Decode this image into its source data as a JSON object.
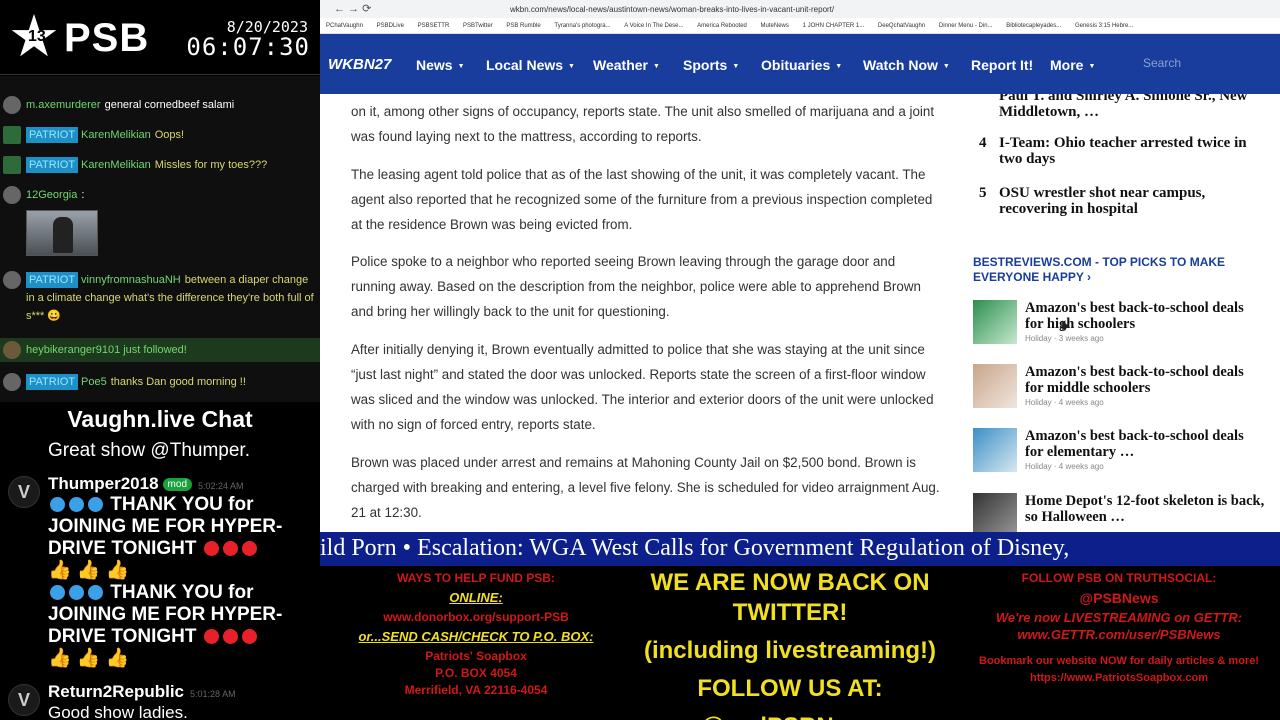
{
  "stream": {
    "logo_text": "PSB",
    "logo_num": "13",
    "date": "8/20/2023",
    "time": "06:07:30"
  },
  "chat_top": {
    "messages": [
      {
        "user": "m.axemurderer",
        "badge": "",
        "text": "general cornedbeef salami"
      },
      {
        "user": "KarenMelikian",
        "badge": "PATRIOT",
        "text": "Oops!"
      },
      {
        "user": "KarenMelikian",
        "badge": "PATRIOT",
        "text": "Missles for my toes???"
      },
      {
        "user": "12Georgia",
        "badge": "",
        "text": ":"
      },
      {
        "user": "vinnyfromnashuaNH",
        "badge": "PATRIOT",
        "text": "between a diaper change in a climate change what's the difference they're both full of s*** 😀"
      },
      {
        "user": "",
        "badge": "",
        "text": "heybikeranger9101 just followed!"
      },
      {
        "user": "Poe5",
        "badge": "PATRIOT",
        "text": "thanks Dan good morning !!"
      }
    ]
  },
  "vaughn": {
    "title": "Vaughn.live Chat",
    "line1": "Great show @Thumper.",
    "user1": "Thumper2018",
    "mod": "mod",
    "time1": "5:02:24 AM",
    "msg_a": "THANK YOU for JOINING ME FOR HYPER-DRIVE TONIGHT",
    "emoji": "👍 👍 👍",
    "user2": "Return2Republic",
    "time2": "5:01:28 AM",
    "msg2": "Good show ladies."
  },
  "browser": {
    "nav": "←  →  ⟳",
    "url": "wkbn.com/news/local-news/austintown-news/woman-breaks-into-lives-in-vacant-unit-report/",
    "bookmarks": [
      "PChatVaughn",
      "PSBDLive",
      "PSBSETTR",
      "PSBTwitter",
      "PSB Rumble",
      "Tyranna's photogra...",
      "A Voice In The Dese...",
      "America Rebooted",
      "MuteNews",
      "1 JOHN CHAPTER 1...",
      "DeeQchatVaughn",
      "Dinner Menu - Din...",
      "Bibliotecapleyades...",
      "Genesis 3:15 Hebre..."
    ],
    "site_logo": "WKBN27",
    "menu": [
      "News",
      "Local News",
      "Weather",
      "Sports",
      "Obituaries",
      "Watch Now",
      "Report It!",
      "More"
    ],
    "search_placeholder": "Search"
  },
  "article": {
    "p0": "on it, among other signs of occupancy, reports state. The unit also smelled of marijuana and a joint was found laying next to the mattress, according to reports.",
    "p1": "The leasing agent told police that as of the last showing of the unit, it was completely vacant. The agent also reported that he recognized some of the furniture from a previous inspection completed at the residence Brown was being evicted from.",
    "p2": "Police spoke to a neighbor who reported seeing Brown leaving through the garage door and running away. Based on the description from the neighbor, police were able to apprehend Brown and bring her willingly back to the unit for questioning.",
    "p3": "After initially denying it, Brown eventually admitted to police that she was staying at the unit since “just last night” and stated the door was unlocked. Reports state the screen of a first-floor window was sliced and the window was unlocked. The interior and exterior doors of the unit were unlocked with no sign of forced entry, reports state.",
    "p4": "Brown was placed under arrest and remains at Mahoning County Jail on $2,500 bond. Brown is charged with breaking and entering, a level five felony. She is scheduled for video arraignment Aug. 21 at 12:30."
  },
  "sidebar": {
    "trending": [
      {
        "num": "",
        "title": "Paul T. and Shirley A. Simone Sr., New Middletown, …"
      },
      {
        "num": "4",
        "title": "I-Team: Ohio teacher arrested twice in two days"
      },
      {
        "num": "5",
        "title": "OSU wrestler shot near campus, recovering in hospital"
      }
    ],
    "best_heading": "BESTREVIEWS.COM - TOP PICKS TO MAKE EVERYONE HAPPY ›",
    "best": [
      {
        "title": "Amazon's best back-to-school deals for high schoolers",
        "meta": "Holiday · 3 weeks ago"
      },
      {
        "title": "Amazon's best back-to-school deals for middle schoolers",
        "meta": "Holiday · 4 weeks ago"
      },
      {
        "title": "Amazon's best back-to-school deals for elementary …",
        "meta": "Holiday · 4 weeks ago"
      },
      {
        "title": "Home Depot's 12-foot skeleton is back, so Halloween …",
        "meta": ""
      }
    ]
  },
  "ticker": {
    "text": "ild Porn  •  Escalation: WGA West Calls for Government Regulation of Disney,"
  },
  "bottom": {
    "left_head": "WAYS TO HELP FUND PSB:",
    "online": "ONLINE:",
    "donor": "www.donorbox.org/support-PSB",
    "send": "or...SEND CASH/CHECK TO P.O. BOX:",
    "addr1": "Patriots' Soapbox",
    "addr2": "P.O. BOX 4054",
    "addr3": "Merrifield, VA 22116-4054",
    "mid1": "WE ARE NOW BACK ON TWITTER!",
    "mid2": "(including livestreaming!)",
    "mid3": "FOLLOW US AT:",
    "mid4": "@realPSBNews",
    "right1": "FOLLOW PSB ON TRUTHSOCIAL:",
    "right2": "@PSBNews",
    "right3": "We're now LIVESTREAMING on GETTR:",
    "right4": "www.GETTR.com/user/PSBNews",
    "right5": "Bookmark our website NOW for daily articles & more!",
    "right6": "https://www.PatriotsSoapbox.com"
  },
  "colors": {
    "nav_blue": "#183d9c",
    "ticker_blue": "#0c1f8a",
    "badge_blue": "#1e90c8",
    "promo_yellow": "#f0e020",
    "promo_red": "#d01818"
  }
}
